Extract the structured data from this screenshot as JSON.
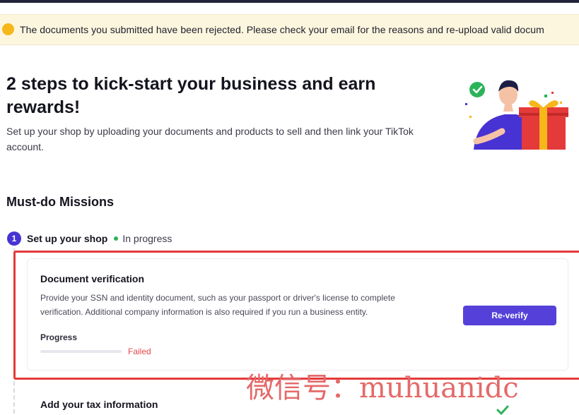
{
  "alert": {
    "message": "The documents you submitted have been rejected. Please check your email for the reasons and re-upload valid docum",
    "icon": "warning-dot-icon",
    "accent": "#f6b71a"
  },
  "hero": {
    "title": "2 steps to kick-start your business and earn rewards!",
    "subtitle": "Set up your shop by uploading your documents and products to sell and then link your TikTok account."
  },
  "missions": {
    "title": "Must-do Missions",
    "step": {
      "number": "1",
      "title": "Set up your shop",
      "status": "In progress",
      "status_color": "#2bb35a"
    }
  },
  "document_card": {
    "title": "Document verification",
    "description": "Provide your SSN and identity document, such as your passport or driver's license to complete verification. Additional company information is also required if you run a business entity.",
    "progress_label": "Progress",
    "progress_status": "Failed",
    "progress_value": 0,
    "button_label": "Re-verify",
    "button_color": "#5541d9"
  },
  "next_task": {
    "title": "Add your tax information"
  },
  "overlay": {
    "text": "微信号：muhuanidc"
  },
  "colors": {
    "primary": "#4733d3",
    "failed": "#e5484d",
    "highlight_border": "#e43a3a"
  }
}
